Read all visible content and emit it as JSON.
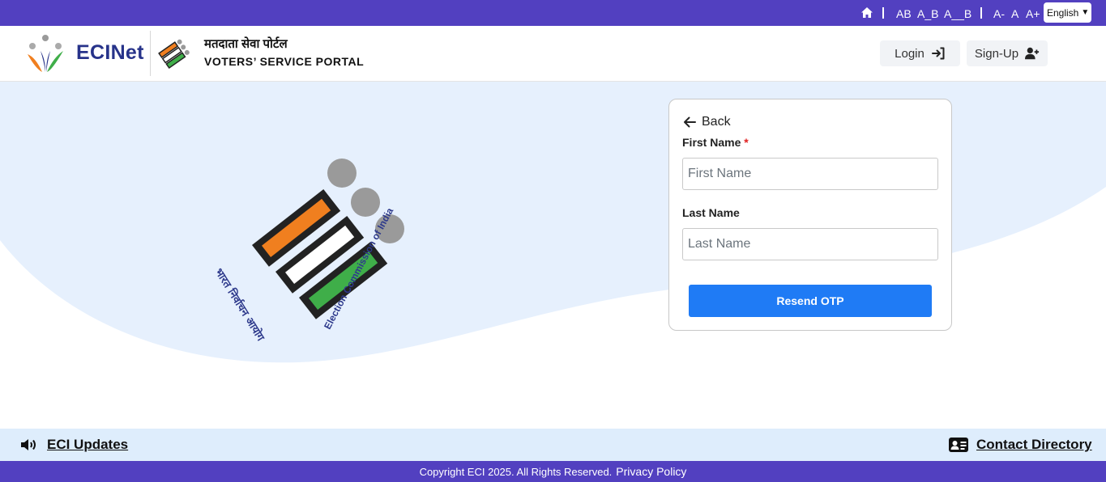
{
  "topbar": {
    "contrast_options": [
      "AB",
      "A_B",
      "A__B"
    ],
    "font_options": [
      "A-",
      "A",
      "A+"
    ],
    "language": "English"
  },
  "header": {
    "brand": "ECINet",
    "portal_hindi": "मतदाता सेवा पोर्टल",
    "portal_english": "VOTERS’ SERVICE PORTAL",
    "login_label": "Login",
    "signup_label": "Sign-Up"
  },
  "form": {
    "back_label": "Back",
    "first_name_label": "First Name",
    "required_mark": "*",
    "first_name_placeholder": "First Name",
    "last_name_label": "Last Name",
    "last_name_placeholder": "Last Name",
    "submit_label": "Resend OTP"
  },
  "emblem": {
    "hindi_text": "भारत निर्वाचन आयोग",
    "english_text": "Election Commission of India"
  },
  "updates": {
    "updates_label": "ECI Updates",
    "contact_label": "Contact Directory"
  },
  "footer": {
    "copyright": "Copyright ECI 2025. All Rights Reserved.",
    "privacy_label": "Privacy Policy"
  },
  "colors": {
    "brand_purple": "#5240c0",
    "primary_blue": "#1f7bf5",
    "light_blue_bg": "#e6f0fd",
    "saffron": "#f07f1f",
    "green": "#3fae49"
  }
}
